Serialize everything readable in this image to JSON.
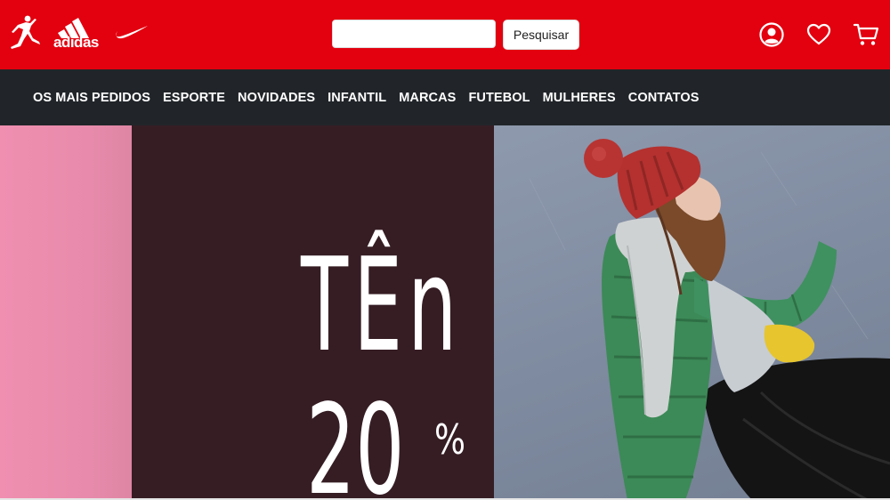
{
  "header": {
    "brands": [
      {
        "name": "jordan-logo",
        "icon": "jumpman-icon"
      },
      {
        "name": "adidas-logo",
        "text": "adidas",
        "icon": "adidas-stripes-icon"
      },
      {
        "name": "nike-logo",
        "icon": "swoosh-icon"
      }
    ],
    "search": {
      "placeholder": "",
      "value": "",
      "button_label": "Pesquisar"
    },
    "actions": [
      {
        "name": "account",
        "icon": "user-circle-icon"
      },
      {
        "name": "favorites",
        "icon": "heart-icon"
      },
      {
        "name": "cart",
        "icon": "cart-icon"
      }
    ],
    "colors": {
      "header_bg": "#e3000f",
      "nav_bg": "#212529",
      "nav_text": "#ffffff"
    }
  },
  "nav": {
    "items": [
      "OS MAIS PEDIDOS",
      "ESPORTE",
      "NOVIDADES",
      "INFANTIL",
      "MARCAS",
      "FUTEBOL",
      "MULHERES",
      "CONTATOS"
    ]
  },
  "banner": {
    "word": "TÊn",
    "number": "20",
    "percent": "%",
    "colors": {
      "pink": "#f08fb0",
      "dark": "#361d24",
      "photo_bg": "#8e99ad"
    }
  }
}
